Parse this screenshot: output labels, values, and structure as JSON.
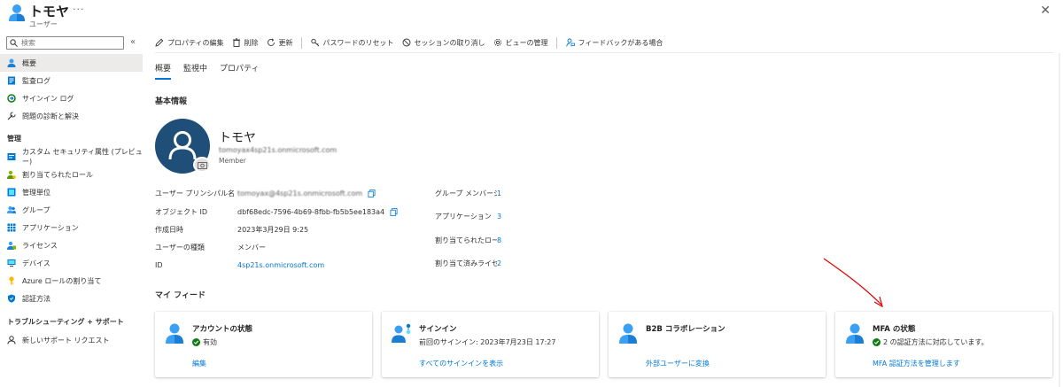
{
  "header": {
    "title": "トモヤ",
    "subtitle": "ユーザー",
    "more": "···",
    "close": "✕"
  },
  "search": {
    "placeholder": "検索"
  },
  "sidebar": {
    "collapse": "«",
    "items": [
      {
        "label": "概要",
        "icon": "user-icon"
      },
      {
        "label": "監査ログ",
        "icon": "audit-log-icon"
      },
      {
        "label": "サインイン ログ",
        "icon": "sign-in-log-icon"
      },
      {
        "label": "問題の診断と解決",
        "icon": "wrench-icon"
      }
    ],
    "section_manage": "管理",
    "manage_items": [
      {
        "label": "カスタム セキュリティ属性 (プレビュー)",
        "icon": "security-attribute-icon"
      },
      {
        "label": "割り当てられたロール",
        "icon": "assigned-roles-icon"
      },
      {
        "label": "管理単位",
        "icon": "admin-unit-icon"
      },
      {
        "label": "グループ",
        "icon": "group-icon"
      },
      {
        "label": "アプリケーション",
        "icon": "apps-grid-icon"
      },
      {
        "label": "ライセンス",
        "icon": "license-icon"
      },
      {
        "label": "デバイス",
        "icon": "device-icon"
      },
      {
        "label": "Azure ロールの割り当て",
        "icon": "key-icon"
      },
      {
        "label": "認証方法",
        "icon": "shield-icon"
      }
    ],
    "section_support": "トラブルシューティング + サポート",
    "support_items": [
      {
        "label": "新しいサポート リクエスト",
        "icon": "support-person-icon"
      }
    ]
  },
  "toolbar": {
    "edit": "プロパティの編集",
    "delete": "削除",
    "refresh": "更新",
    "reset_password": "パスワードのリセット",
    "revoke_sessions": "セッションの取り消し",
    "manage_view": "ビューの管理",
    "feedback": "フィードバックがある場合"
  },
  "tabs": [
    "概要",
    "監視中",
    "プロパティ"
  ],
  "basic_info": {
    "title": "基本情報",
    "name": "トモヤ",
    "upn_masked": "tomoyax4sp21s.onmicrosoft.com",
    "user_type": "Member"
  },
  "properties": [
    {
      "label": "ユーザー プリンシパル名",
      "value": "tomoyax@4sp21s.onmicrosoft.com"
    },
    {
      "label": "オブジェクト ID",
      "value": "dbf68edc-7596-4b69-8fbb-fb5b5ee183a4"
    },
    {
      "label": "作成日時",
      "value": "2023年3月29日 9:25"
    },
    {
      "label": "ユーザーの種類",
      "value": "メンバー"
    },
    {
      "label": "ID",
      "value": "4sp21s.onmicrosoft.com"
    }
  ],
  "stats": [
    {
      "label": "グループ メンバーシップ",
      "value": "1"
    },
    {
      "label": "アプリケーション",
      "value": "3"
    },
    {
      "label": "割り当てられたロール",
      "value": "8"
    },
    {
      "label": "割り当て済みライセンス",
      "value": "2"
    }
  ],
  "feed": {
    "title": "マイ フィード",
    "cards": [
      {
        "title": "アカウントの状態",
        "status": "有効",
        "link": "編集",
        "icon": "user-icon"
      },
      {
        "title": "サインイン",
        "status": "前回のサインイン: 2023年7月23日 17:27",
        "link": "すべてのサインインを表示",
        "icon": "user-sign-in-icon"
      },
      {
        "title": "B2B コラボレーション",
        "status": "",
        "link": "外部ユーザーに変換",
        "icon": "user-icon"
      },
      {
        "title": "MFA の状態",
        "status": "2 の認証方法に対応しています。",
        "link": "MFA 認証方法を管理します",
        "icon": "user-icon"
      }
    ]
  },
  "colors": {
    "accent": "#0078d4",
    "avatar": "#1f4e79",
    "success": "#107c10",
    "annotation": "#e00000"
  }
}
